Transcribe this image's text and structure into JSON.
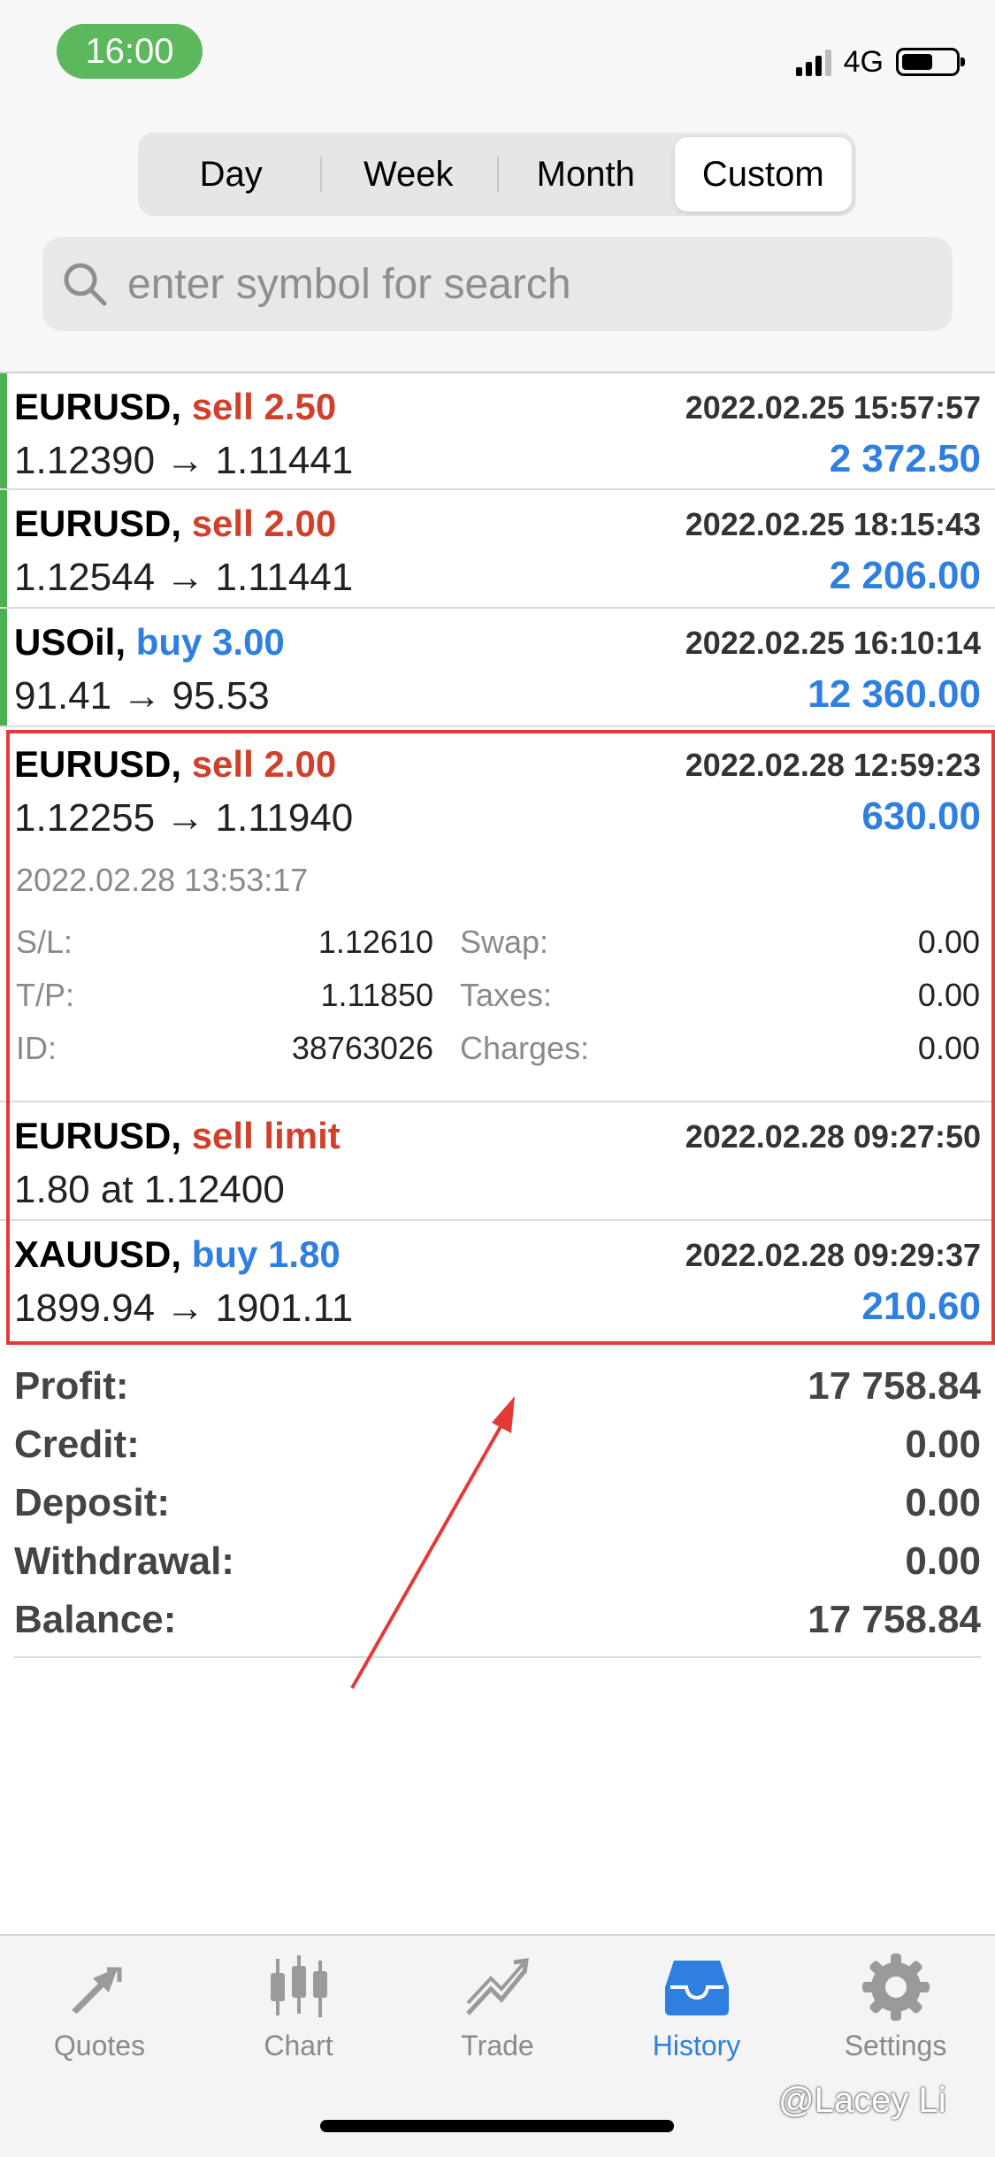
{
  "status": {
    "time": "16:00",
    "network": "4G"
  },
  "segments": [
    {
      "label": "Day"
    },
    {
      "label": "Week"
    },
    {
      "label": "Month"
    },
    {
      "label": "Custom"
    }
  ],
  "search": {
    "placeholder": "enter symbol for search"
  },
  "trades": [
    {
      "symbol": "EURUSD,",
      "action": "sell 2.50",
      "date": "2022.02.25 15:57:57",
      "price": "1.12390 → 1.11441",
      "profit": "2 372.50"
    },
    {
      "symbol": "EURUSD,",
      "action": "sell 2.00",
      "date": "2022.02.25 18:15:43",
      "price": "1.12544 → 1.11441",
      "profit": "2 206.00"
    },
    {
      "symbol": "USOil,",
      "action": "buy 3.00",
      "date": "2022.02.25 16:10:14",
      "price": "91.41 → 95.53",
      "profit": "12 360.00"
    }
  ],
  "expanded": {
    "symbol": "EURUSD,",
    "action": "sell 2.00",
    "date": "2022.02.28 12:59:23",
    "price": "1.12255 → 1.11940",
    "profit": "630.00",
    "close_time": "2022.02.28 13:53:17",
    "sl_label": "S/L:",
    "sl": "1.12610",
    "tp_label": "T/P:",
    "tp": "1.11850",
    "id_label": "ID:",
    "id": "38763026",
    "swap_label": "Swap:",
    "swap": "0.00",
    "taxes_label": "Taxes:",
    "taxes": "0.00",
    "charges_label": "Charges:",
    "charges": "0.00"
  },
  "order": {
    "symbol": "EURUSD,",
    "action": "sell limit",
    "date": "2022.02.28 09:27:50",
    "detail": "1.80 at 1.12400"
  },
  "last_trade": {
    "symbol": "XAUUSD,",
    "action": "buy 1.80",
    "date": "2022.02.28 09:29:37",
    "price": "1899.94 → 1901.11",
    "profit": "210.60"
  },
  "summary": [
    {
      "label": "Profit:",
      "value": "17 758.84"
    },
    {
      "label": "Credit:",
      "value": "0.00"
    },
    {
      "label": "Deposit:",
      "value": "0.00"
    },
    {
      "label": "Withdrawal:",
      "value": "0.00"
    },
    {
      "label": "Balance:",
      "value": "17 758.84"
    }
  ],
  "tabs": [
    {
      "label": "Quotes",
      "icon": "quotes-icon"
    },
    {
      "label": "Chart",
      "icon": "chart-icon"
    },
    {
      "label": "Trade",
      "icon": "trade-icon"
    },
    {
      "label": "History",
      "icon": "history-icon"
    },
    {
      "label": "Settings",
      "icon": "settings-icon"
    }
  ],
  "watermark": "@Lacey Li",
  "colors": {
    "sell": "#d0402a",
    "buy": "#2e7fe0",
    "accent": "#2e7fe0",
    "highlight": "#e53935",
    "marker": "#4caf50"
  }
}
